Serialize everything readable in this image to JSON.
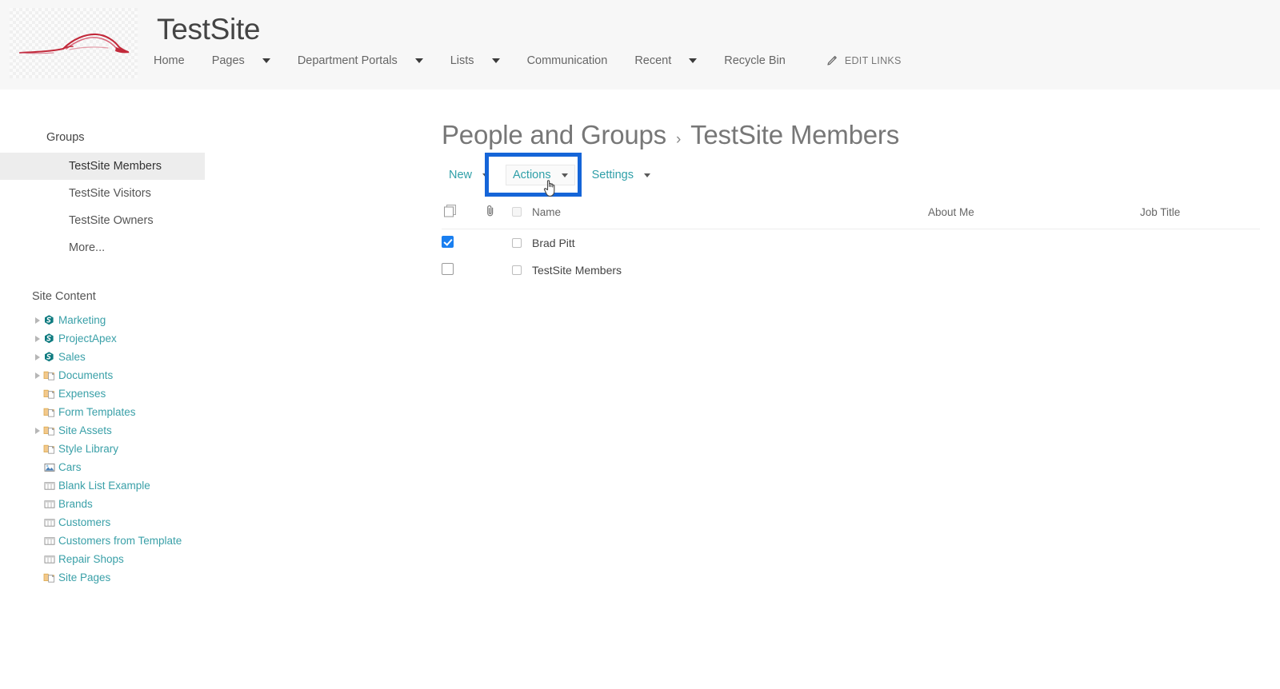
{
  "header": {
    "site_title": "TestSite",
    "logo_icon": "car-silhouette-logo",
    "nav": [
      {
        "label": "Home",
        "has_dropdown": false,
        "icon": ""
      },
      {
        "label": "Pages",
        "has_dropdown": true,
        "icon": "chevron-down-icon"
      },
      {
        "label": "Department Portals",
        "has_dropdown": true,
        "icon": "chevron-down-icon"
      },
      {
        "label": "Lists",
        "has_dropdown": true,
        "icon": "chevron-down-icon"
      },
      {
        "label": "Communication",
        "has_dropdown": false,
        "icon": ""
      },
      {
        "label": "Recent",
        "has_dropdown": true,
        "icon": "chevron-down-icon"
      },
      {
        "label": "Recycle Bin",
        "has_dropdown": false,
        "icon": ""
      }
    ],
    "edit_links_label": "EDIT LINKS",
    "edit_links_icon": "pencil-icon",
    "background_color": "#f7f7f7"
  },
  "sidebar": {
    "groups_heading": "Groups",
    "groups": [
      {
        "label": "TestSite Members",
        "selected": true
      },
      {
        "label": "TestSite Visitors",
        "selected": false
      },
      {
        "label": "TestSite Owners",
        "selected": false
      },
      {
        "label": "More...",
        "selected": false
      }
    ],
    "site_content_heading": "Site Content",
    "tree": [
      {
        "label": "Marketing",
        "icon": "sharepoint-site-icon",
        "expandable": true
      },
      {
        "label": "ProjectApex",
        "icon": "sharepoint-site-icon",
        "expandable": true
      },
      {
        "label": "Sales",
        "icon": "sharepoint-site-icon",
        "expandable": true
      },
      {
        "label": "Documents",
        "icon": "document-library-icon",
        "expandable": true
      },
      {
        "label": "Expenses",
        "icon": "document-library-icon",
        "expandable": false
      },
      {
        "label": "Form Templates",
        "icon": "document-library-icon",
        "expandable": false
      },
      {
        "label": "Site Assets",
        "icon": "document-library-icon",
        "expandable": true
      },
      {
        "label": "Style Library",
        "icon": "document-library-icon",
        "expandable": false
      },
      {
        "label": "Cars",
        "icon": "picture-library-icon",
        "expandable": false
      },
      {
        "label": "Blank List Example",
        "icon": "list-icon",
        "expandable": false
      },
      {
        "label": "Brands",
        "icon": "list-icon",
        "expandable": false
      },
      {
        "label": "Customers",
        "icon": "list-icon",
        "expandable": false
      },
      {
        "label": "Customers from Template",
        "icon": "list-icon",
        "expandable": false
      },
      {
        "label": "Repair Shops",
        "icon": "list-icon",
        "expandable": false
      },
      {
        "label": "Site Pages",
        "icon": "document-library-icon",
        "expandable": false
      }
    ],
    "link_color": "#3aa0a8"
  },
  "main": {
    "breadcrumb_root": "People and Groups",
    "breadcrumb_separator": "›",
    "breadcrumb_current": "TestSite Members",
    "toolbar": [
      {
        "label": "New",
        "has_caret": true,
        "hovered": false
      },
      {
        "label": "Actions",
        "has_caret": true,
        "hovered": true
      },
      {
        "label": "Settings",
        "has_caret": true,
        "hovered": false
      }
    ],
    "highlight_color": "#1565d8",
    "cursor_icon": "pointing-hand-cursor",
    "table": {
      "select_all_icon": "select-all-pages-icon",
      "attachment_icon": "paperclip-icon",
      "columns": [
        "Name",
        "About Me",
        "Job Title"
      ],
      "rows": [
        {
          "selected": true,
          "name": "Brad Pitt",
          "about_me": "",
          "job_title": ""
        },
        {
          "selected": false,
          "name": "TestSite Members",
          "about_me": "",
          "job_title": ""
        }
      ]
    }
  }
}
